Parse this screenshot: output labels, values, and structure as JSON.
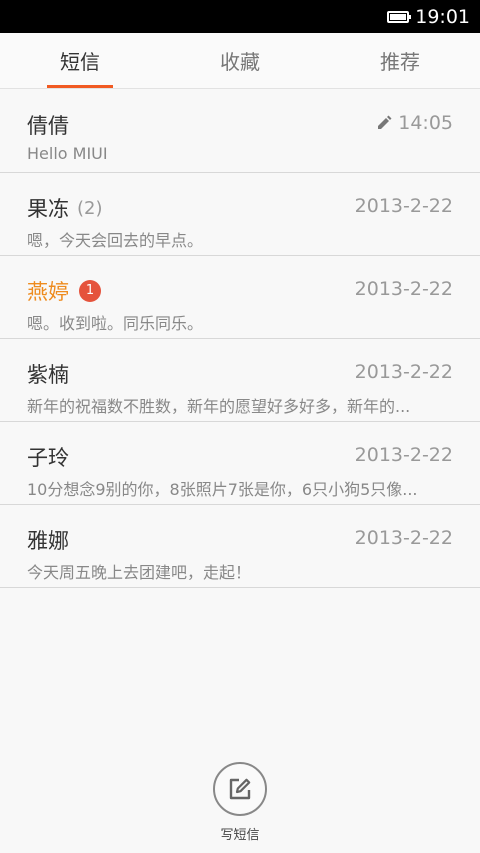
{
  "status_bar": {
    "time": "19:01"
  },
  "tabs": [
    {
      "label": "短信",
      "active": true
    },
    {
      "label": "收藏",
      "active": false
    },
    {
      "label": "推荐",
      "active": false
    }
  ],
  "messages": [
    {
      "name": "倩倩",
      "count": "",
      "badge": "",
      "time": "14:05",
      "draft": true,
      "preview": "Hello MIUI"
    },
    {
      "name": "果冻",
      "count": "(2)",
      "badge": "",
      "time": "2013-2-22",
      "draft": false,
      "preview": "嗯，今天会回去的早点。"
    },
    {
      "name": "燕婷",
      "count": "",
      "badge": "1",
      "time": "2013-2-22",
      "draft": false,
      "preview": "嗯。收到啦。同乐同乐。"
    },
    {
      "name": "紫楠",
      "count": "",
      "badge": "",
      "time": "2013-2-22",
      "draft": false,
      "preview": "新年的祝福数不胜数，新年的愿望好多好多，新年的..."
    },
    {
      "name": "子玲",
      "count": "",
      "badge": "",
      "time": "2013-2-22",
      "draft": false,
      "preview": "10分想念9别的你，8张照片7张是你，6只小狗5只像..."
    },
    {
      "name": "雅娜",
      "count": "",
      "badge": "",
      "time": "2013-2-22",
      "draft": false,
      "preview": "今天周五晚上去团建吧，走起！"
    }
  ],
  "compose": {
    "label": "写短信"
  },
  "colors": {
    "accent": "#f15a22",
    "unread_name": "#ee8b1e",
    "badge": "#e5533c"
  }
}
